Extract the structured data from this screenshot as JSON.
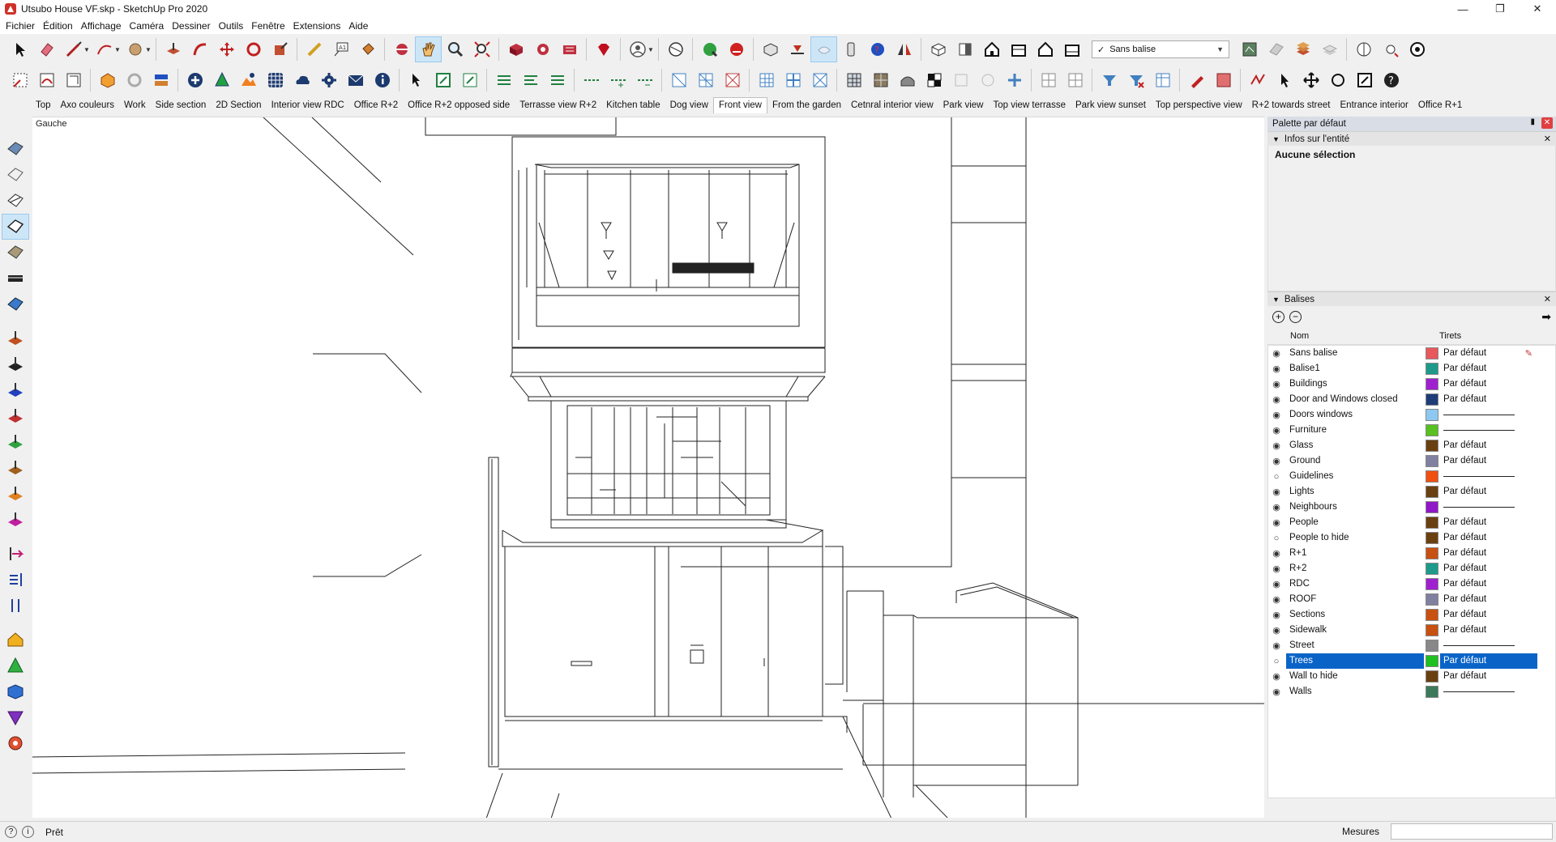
{
  "window": {
    "title": "Utsubo House VF.skp - SketchUp Pro 2020",
    "controls": [
      "minimize-icon",
      "maximize-icon",
      "close-icon"
    ]
  },
  "menu": [
    "Fichier",
    "Édition",
    "Affichage",
    "Caméra",
    "Dessiner",
    "Outils",
    "Fenêtre",
    "Extensions",
    "Aide"
  ],
  "toolbar": {
    "active_tag": "Sans balise",
    "active_tag_check": "✓"
  },
  "scenes": [
    "Top",
    "Axo couleurs",
    "Work",
    "Side section",
    "2D Section",
    "Interior view RDC",
    "Office R+2",
    "Office R+2 opposed side",
    "Terrasse view R+2",
    "Kitchen table",
    "Dog view",
    "Front view",
    "From the garden",
    "Cetnral interior view",
    "Park view",
    "Top view terrasse",
    "Park view sunset",
    "Top perspective view",
    "R+2 towards street",
    "Entrance interior",
    "Office R+1"
  ],
  "active_scene": "Front view",
  "viewport": {
    "label": "Gauche"
  },
  "panel": {
    "title": "Palette par défaut",
    "entity_info": {
      "heading": "Infos sur l'entité",
      "selection": "Aucune sélection"
    },
    "tags": {
      "heading": "Balises",
      "col_name": "Nom",
      "col_dash": "Tirets",
      "rows": [
        {
          "name": "Sans balise",
          "visible": true,
          "color": "#e8585c",
          "dash": "Par défaut",
          "current": true
        },
        {
          "name": "Balise1",
          "visible": true,
          "color": "#1e9a8a",
          "dash": "Par défaut"
        },
        {
          "name": "Buildings",
          "visible": true,
          "color": "#a020d0",
          "dash": "Par défaut"
        },
        {
          "name": "Door and Windows closed",
          "visible": true,
          "color": "#1e3c78",
          "dash": "Par défaut"
        },
        {
          "name": "Doors windows",
          "visible": true,
          "color": "#8cc8f0",
          "dash": ""
        },
        {
          "name": "Furniture",
          "visible": true,
          "color": "#58c020",
          "dash": ""
        },
        {
          "name": "Glass",
          "visible": true,
          "color": "#6a4010",
          "dash": "Par défaut"
        },
        {
          "name": "Ground",
          "visible": true,
          "color": "#8080a0",
          "dash": "Par défaut"
        },
        {
          "name": "Guidelines",
          "visible": false,
          "color": "#f05010",
          "dash": ""
        },
        {
          "name": "Lights",
          "visible": true,
          "color": "#6a4010",
          "dash": "Par défaut"
        },
        {
          "name": "Neighbours",
          "visible": true,
          "color": "#9018c8",
          "dash": ""
        },
        {
          "name": "People",
          "visible": true,
          "color": "#6a4010",
          "dash": "Par défaut"
        },
        {
          "name": "People to hide",
          "visible": false,
          "color": "#6a4010",
          "dash": "Par défaut"
        },
        {
          "name": "R+1",
          "visible": true,
          "color": "#c85010",
          "dash": "Par défaut"
        },
        {
          "name": "R+2",
          "visible": true,
          "color": "#1e9a8a",
          "dash": "Par défaut"
        },
        {
          "name": "RDC",
          "visible": true,
          "color": "#a020d0",
          "dash": "Par défaut"
        },
        {
          "name": "ROOF",
          "visible": true,
          "color": "#8080a0",
          "dash": "Par défaut"
        },
        {
          "name": "Sections",
          "visible": true,
          "color": "#c85010",
          "dash": "Par défaut"
        },
        {
          "name": "Sidewalk",
          "visible": true,
          "color": "#c85010",
          "dash": "Par défaut"
        },
        {
          "name": "Street",
          "visible": true,
          "color": "#888888",
          "dash": ""
        },
        {
          "name": "Trees",
          "visible": false,
          "color": "#20c020",
          "dash": "Par défaut",
          "selected": true
        },
        {
          "name": "Wall to hide",
          "visible": true,
          "color": "#6a4010",
          "dash": "Par défaut"
        },
        {
          "name": "Walls",
          "visible": true,
          "color": "#3c7a5a",
          "dash": ""
        }
      ]
    }
  },
  "status": {
    "text": "Prêt",
    "measures_label": "Mesures",
    "measures_value": ""
  }
}
